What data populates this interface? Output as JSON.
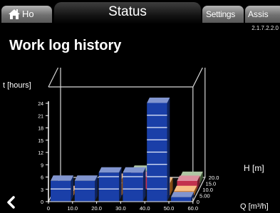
{
  "tabs": {
    "home": "Ho",
    "status": "Status",
    "settings": "Settings",
    "assist": "Assis"
  },
  "version": "2.1.7.2.2.0",
  "page_title": "Work log history",
  "chart_data": {
    "type": "bar3d",
    "title": "Work log history",
    "zlabel": "t [hours]",
    "xlabel": "Q [m³/h]",
    "ylabel": "H [m]",
    "z_ticks": [
      "24",
      "21",
      "18",
      "15",
      "12",
      "9",
      "6",
      "3",
      "0"
    ],
    "x_ticks": [
      "0",
      "10.0",
      "20.0",
      "30.0",
      "40.0",
      "50.0",
      "60.0"
    ],
    "y_ticks": [
      "0",
      "5.00",
      "10.0",
      "15.0",
      "20.0"
    ],
    "x_centers": [
      5,
      15,
      25,
      35,
      45,
      55
    ],
    "y_centers": [
      2.5,
      7.5,
      12.5,
      17.5
    ],
    "zlim": [
      0,
      24
    ],
    "bars": [
      {
        "x": 5,
        "y": 2.5,
        "h": 5,
        "color": "#1a3fa8"
      },
      {
        "x": 15,
        "y": 2.5,
        "h": 5,
        "color": "#1a3fa8"
      },
      {
        "x": 25,
        "y": 2.5,
        "h": 7,
        "color": "#1a3fa8"
      },
      {
        "x": 35,
        "y": 2.5,
        "h": 7,
        "color": "#1a3fa8"
      },
      {
        "x": 45,
        "y": 2.5,
        "h": 24,
        "color": "#1a3fa8"
      },
      {
        "x": 55,
        "y": 2.5,
        "h": 1,
        "color": "#1a3fa8"
      },
      {
        "x": 5,
        "y": 7.5,
        "h": 1,
        "color": "#f08a24"
      },
      {
        "x": 25,
        "y": 7.5,
        "h": 4,
        "color": "#f08a24"
      },
      {
        "x": 45,
        "y": 7.5,
        "h": 3,
        "color": "#f08a24"
      },
      {
        "x": 55,
        "y": 7.5,
        "h": 1,
        "color": "#f08a24"
      },
      {
        "x": 35,
        "y": 12.5,
        "h": 3,
        "color": "#c2314e"
      },
      {
        "x": 55,
        "y": 12.5,
        "h": 2,
        "color": "#c2314e"
      },
      {
        "x": 35,
        "y": 17.5,
        "h": 3,
        "color": "#6f9a5c"
      },
      {
        "x": 55,
        "y": 17.5,
        "h": 1.5,
        "color": "#6f9a5c"
      }
    ]
  }
}
